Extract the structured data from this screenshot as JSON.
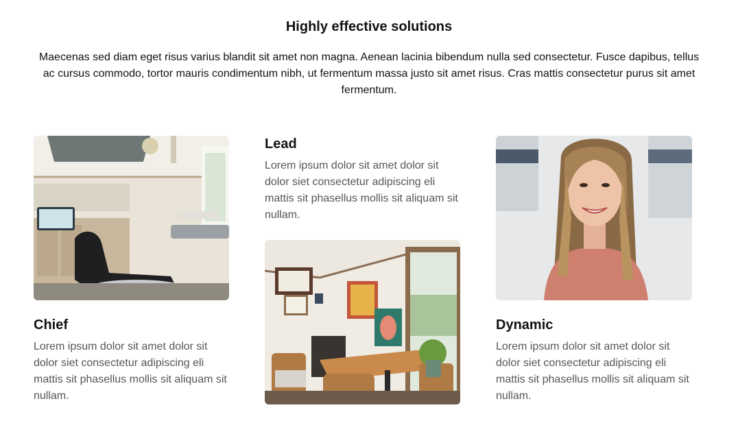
{
  "section": {
    "title": "Highly effective solutions",
    "intro": "Maecenas sed diam eget risus varius blandit sit amet non magna. Aenean lacinia bibendum nulla sed consectetur. Fusce dapibus, tellus ac cursus commodo, tortor mauris condimentum nibh, ut fermentum massa justo sit amet risus. Cras mattis consectetur purus sit amet fermentum."
  },
  "cards": [
    {
      "title": "Chief",
      "text": "Lorem ipsum dolor sit amet dolor sit dolor siet consectetur adipiscing eli mattis sit phasellus mollis sit aliquam sit nullam.",
      "image": "dental-office-photo"
    },
    {
      "title": "Lead",
      "text": "Lorem ipsum dolor sit amet dolor sit dolor siet consectetur adipiscing eli mattis sit phasellus mollis sit aliquam sit nullam.",
      "image": "consultation-room-photo"
    },
    {
      "title": "Dynamic",
      "text": "Lorem ipsum dolor sit amet dolor sit dolor siet consectetur adipiscing eli mattis sit phasellus mollis sit aliquam sit nullam.",
      "image": "portrait-photo"
    }
  ],
  "colors": {
    "heading": "#111111",
    "body_text": "#555555",
    "background": "#ffffff"
  }
}
